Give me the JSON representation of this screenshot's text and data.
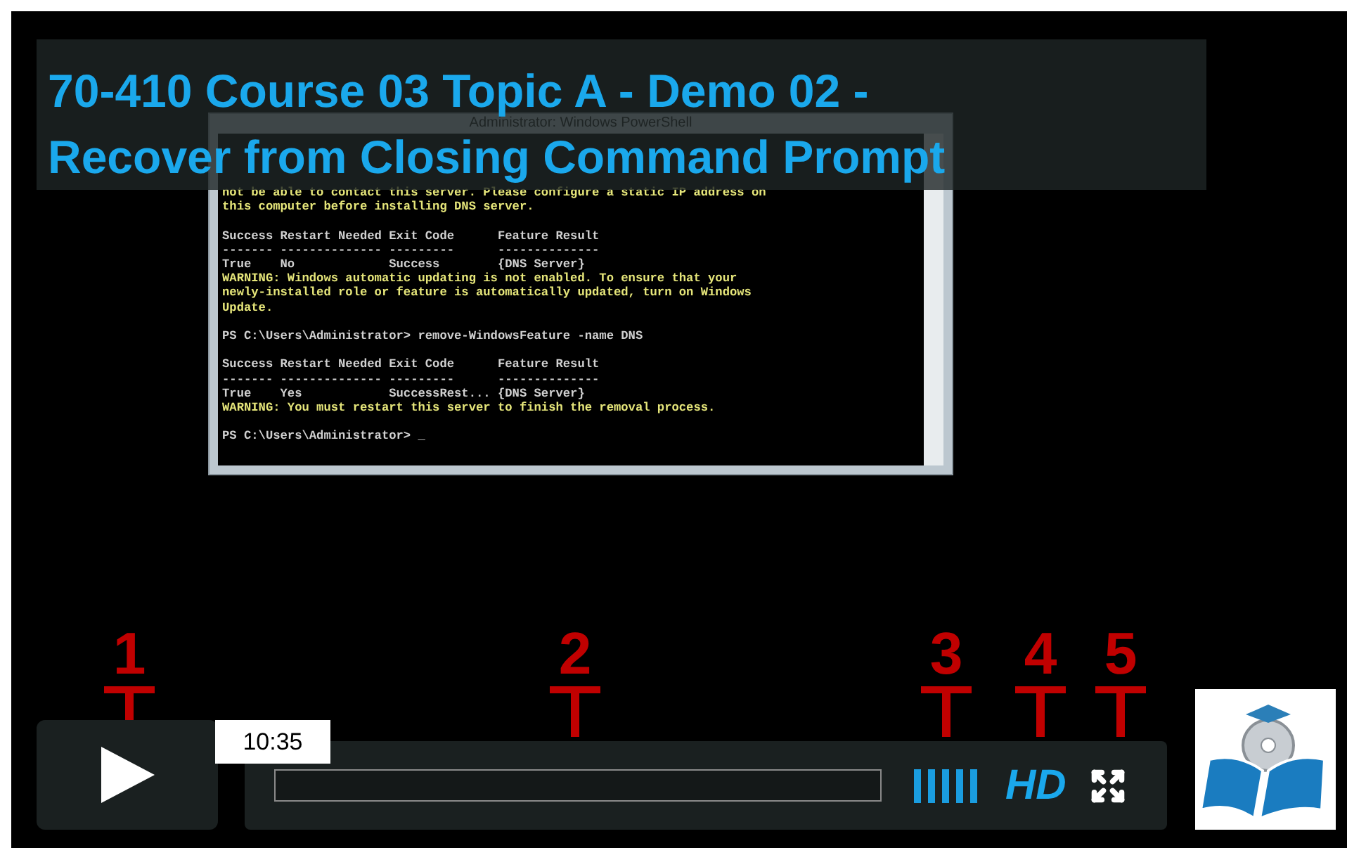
{
  "video": {
    "title_lines": [
      "70-410 Course 03 Topic A - Demo 02 -",
      "Recover from Closing Command Prompt"
    ],
    "console_window": {
      "title": "Administrator: Windows PowerShell",
      "blocks": [
        {
          "lines": [
            {
              "text": "not be able to contact this server. Please configure a static IP address on",
              "kind": "warning"
            },
            {
              "text": "this computer before installing DNS server.",
              "kind": "warning"
            }
          ]
        },
        {
          "lines": [
            {
              "text": "Success Restart Needed Exit Code      Feature Result",
              "kind": "output"
            },
            {
              "text": "------- -------------- ---------      --------------",
              "kind": "output"
            },
            {
              "text": "True    No             Success        {DNS Server}",
              "kind": "output"
            },
            {
              "text": "WARNING: Windows automatic updating is not enabled. To ensure that your",
              "kind": "warning"
            },
            {
              "text": "newly-installed role or feature is automatically updated, turn on Windows",
              "kind": "warning"
            },
            {
              "text": "Update.",
              "kind": "warning"
            }
          ]
        },
        {
          "lines": [
            {
              "text": "PS C:\\Users\\Administrator> remove-WindowsFeature -name DNS",
              "kind": "output"
            }
          ]
        },
        {
          "lines": [
            {
              "text": "Success Restart Needed Exit Code      Feature Result",
              "kind": "output"
            },
            {
              "text": "------- -------------- ---------      --------------",
              "kind": "output"
            },
            {
              "text": "True    Yes            SuccessRest... {DNS Server}",
              "kind": "output"
            },
            {
              "text": "WARNING: You must restart this server to finish the removal process.",
              "kind": "warning"
            }
          ]
        },
        {
          "lines": [
            {
              "text": "PS C:\\Users\\Administrator> _",
              "kind": "output"
            }
          ]
        }
      ]
    }
  },
  "annotations": [
    "1",
    "2",
    "3",
    "4",
    "5"
  ],
  "controls": {
    "seek_tooltip": "10:35",
    "quality_label": "HD"
  }
}
